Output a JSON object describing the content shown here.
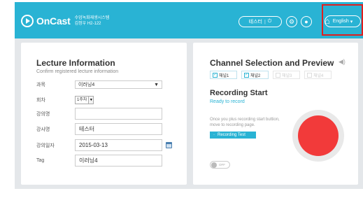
{
  "header": {
    "brand": "OnCast",
    "subtitle_line1": "수업녹화재생시스템",
    "subtitle_line2": "김정우 H2-122",
    "user_name": "테스터",
    "power_glyph": "⏻",
    "language": "English",
    "language_caret": "▾",
    "icons": [
      "oncast-play-logo-icon",
      "power-icon",
      "settings-icon",
      "user-icon",
      "home-icon"
    ],
    "accent_color": "#29b3d4",
    "highlight_color": "#e01e1e"
  },
  "lecture": {
    "title": "Lecture Information",
    "subtitle": "Confirm registered lecture information",
    "fields": [
      {
        "label": "과목",
        "value": "이러닝4"
      },
      {
        "label": "회차",
        "value": "1주차"
      },
      {
        "label": "강의명",
        "value": ""
      },
      {
        "label": "강사명",
        "value": "테스터"
      },
      {
        "label": "강의일자",
        "value": "2015-03-13"
      },
      {
        "label": "Tag",
        "value": "이러닝4"
      }
    ]
  },
  "channel": {
    "title": "Channel Selection and Preview",
    "channels": [
      {
        "label": "채널1",
        "checked": true,
        "enabled": true
      },
      {
        "label": "채널2",
        "checked": true,
        "enabled": true
      },
      {
        "label": "채널3",
        "checked": false,
        "enabled": false
      },
      {
        "label": "채널4",
        "checked": false,
        "enabled": false
      }
    ]
  },
  "recording": {
    "title": "Recording Start",
    "status": "Ready to record",
    "description": "Once you plus recording start buttion, move to recording page.",
    "test_button": "Recording Test",
    "toggle_label": "OFF",
    "button_color": "#f23a3a"
  }
}
